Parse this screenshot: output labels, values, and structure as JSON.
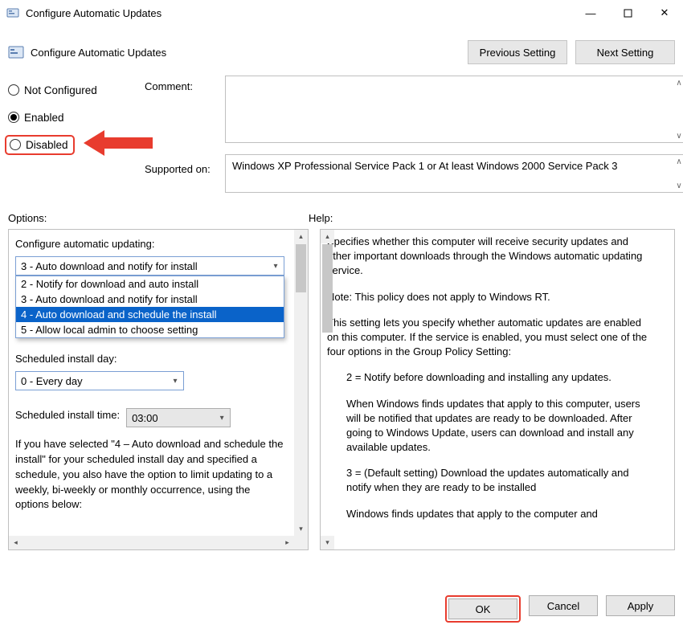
{
  "window": {
    "title": "Configure Automatic Updates",
    "minimize": "—",
    "maximize": "▢",
    "close": "✕"
  },
  "header": {
    "title": "Configure Automatic Updates",
    "prev": "Previous Setting",
    "next": "Next Setting"
  },
  "state": {
    "not_configured": "Not Configured",
    "enabled": "Enabled",
    "disabled": "Disabled",
    "comment_label": "Comment:",
    "supported_label": "Supported on:",
    "supported_text": "Windows XP Professional Service Pack 1 or At least Windows 2000 Service Pack 3"
  },
  "mid": {
    "options": "Options:",
    "help": "Help:"
  },
  "options": {
    "config_label": "Configure automatic updating:",
    "combo_selected": "3 - Auto download and notify for install",
    "dd": {
      "o1": "2 - Notify for download and auto install",
      "o2": "3 - Auto download and notify for install",
      "o3": "4 - Auto download and schedule the install",
      "o4": "5 - Allow local admin to choose setting"
    },
    "sched_day_label": "Scheduled install day:",
    "sched_day_value": "0 - Every day",
    "sched_time_label": "Scheduled install time:",
    "sched_time_value": "03:00",
    "note": "If you have selected \"4 – Auto download and schedule the install\" for your scheduled install day and specified a schedule, you also have the option to limit updating to a weekly, bi-weekly or monthly occurrence, using the options below:"
  },
  "help": {
    "p1": "Specifies whether this computer will receive security updates and other important downloads through the Windows automatic updating service.",
    "p2": "Note: This policy does not apply to Windows RT.",
    "p3": "This setting lets you specify whether automatic updates are enabled on this computer. If the service is enabled, you must select one of the four options in the Group Policy Setting:",
    "p4": "2 = Notify before downloading and installing any updates.",
    "p5": "When Windows finds updates that apply to this computer, users will be notified that updates are ready to be downloaded. After going to Windows Update, users can download and install any available updates.",
    "p6": "3 = (Default setting) Download the updates automatically and notify when they are ready to be installed",
    "p7": "Windows finds updates that apply to the computer and"
  },
  "footer": {
    "ok": "OK",
    "cancel": "Cancel",
    "apply": "Apply"
  }
}
